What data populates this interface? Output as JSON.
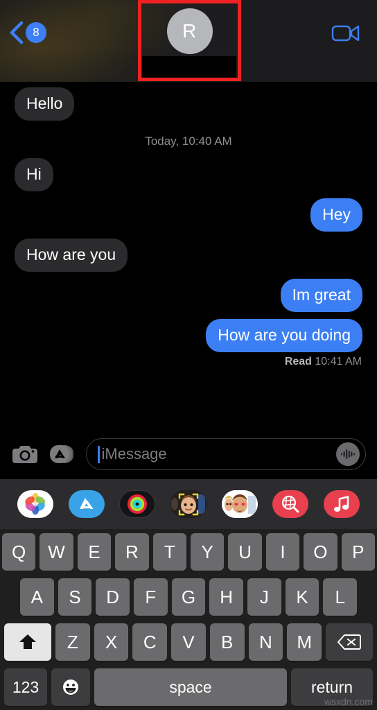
{
  "header": {
    "back_badge_count": "8",
    "back_icon": "chevron-left-icon",
    "avatar_initial": "R",
    "contact_name_redacted": "",
    "facetime_icon": "video-camera-icon",
    "annotation_color": "#ee2222"
  },
  "conversation": {
    "messages": [
      {
        "id": 1,
        "text": "Hello",
        "side": "in"
      },
      {
        "id": 2,
        "type": "timestamp",
        "text": "Today, 10:40 AM"
      },
      {
        "id": 3,
        "text": "Hi",
        "side": "in"
      },
      {
        "id": 4,
        "text": "Hey",
        "side": "out"
      },
      {
        "id": 5,
        "text": "How are you",
        "side": "in"
      },
      {
        "id": 6,
        "text": "Im great",
        "side": "out"
      },
      {
        "id": 7,
        "text": "How are you doing",
        "side": "out"
      }
    ],
    "read_receipt": {
      "status": "Read",
      "time": "10:41 AM"
    },
    "bubble_in_color": "#2b2b2d",
    "bubble_out_color": "#3c7ff5"
  },
  "input_bar": {
    "camera_icon": "camera-icon",
    "apps_icon": "app-store-icon",
    "placeholder": "iMessage",
    "value": "",
    "audio_icon": "audio-waveform-icon"
  },
  "app_drawer": {
    "items": [
      {
        "name": "photos-app-icon",
        "label": "Photos"
      },
      {
        "name": "app-store-app-icon",
        "label": "App Store"
      },
      {
        "name": "fitness-rings-app-icon",
        "label": "Fitness"
      },
      {
        "name": "memoji-app-icon",
        "label": "Memoji"
      },
      {
        "name": "memoji-stickers-app-icon",
        "label": "Memoji Stickers"
      },
      {
        "name": "images-search-app-icon",
        "label": "#images"
      },
      {
        "name": "music-app-icon",
        "label": "Music"
      }
    ]
  },
  "keyboard": {
    "row1": [
      "Q",
      "W",
      "E",
      "R",
      "T",
      "Y",
      "U",
      "I",
      "O",
      "P"
    ],
    "row2": [
      "A",
      "S",
      "D",
      "F",
      "G",
      "H",
      "J",
      "K",
      "L"
    ],
    "row3": [
      "Z",
      "X",
      "C",
      "V",
      "B",
      "N",
      "M"
    ],
    "shift_label": "shift-icon",
    "delete_label": "delete-icon",
    "numbers_key": "123",
    "emoji_key": "emoji-icon",
    "space_key": "space",
    "return_key": "return"
  },
  "watermark": "wsxdn.com"
}
